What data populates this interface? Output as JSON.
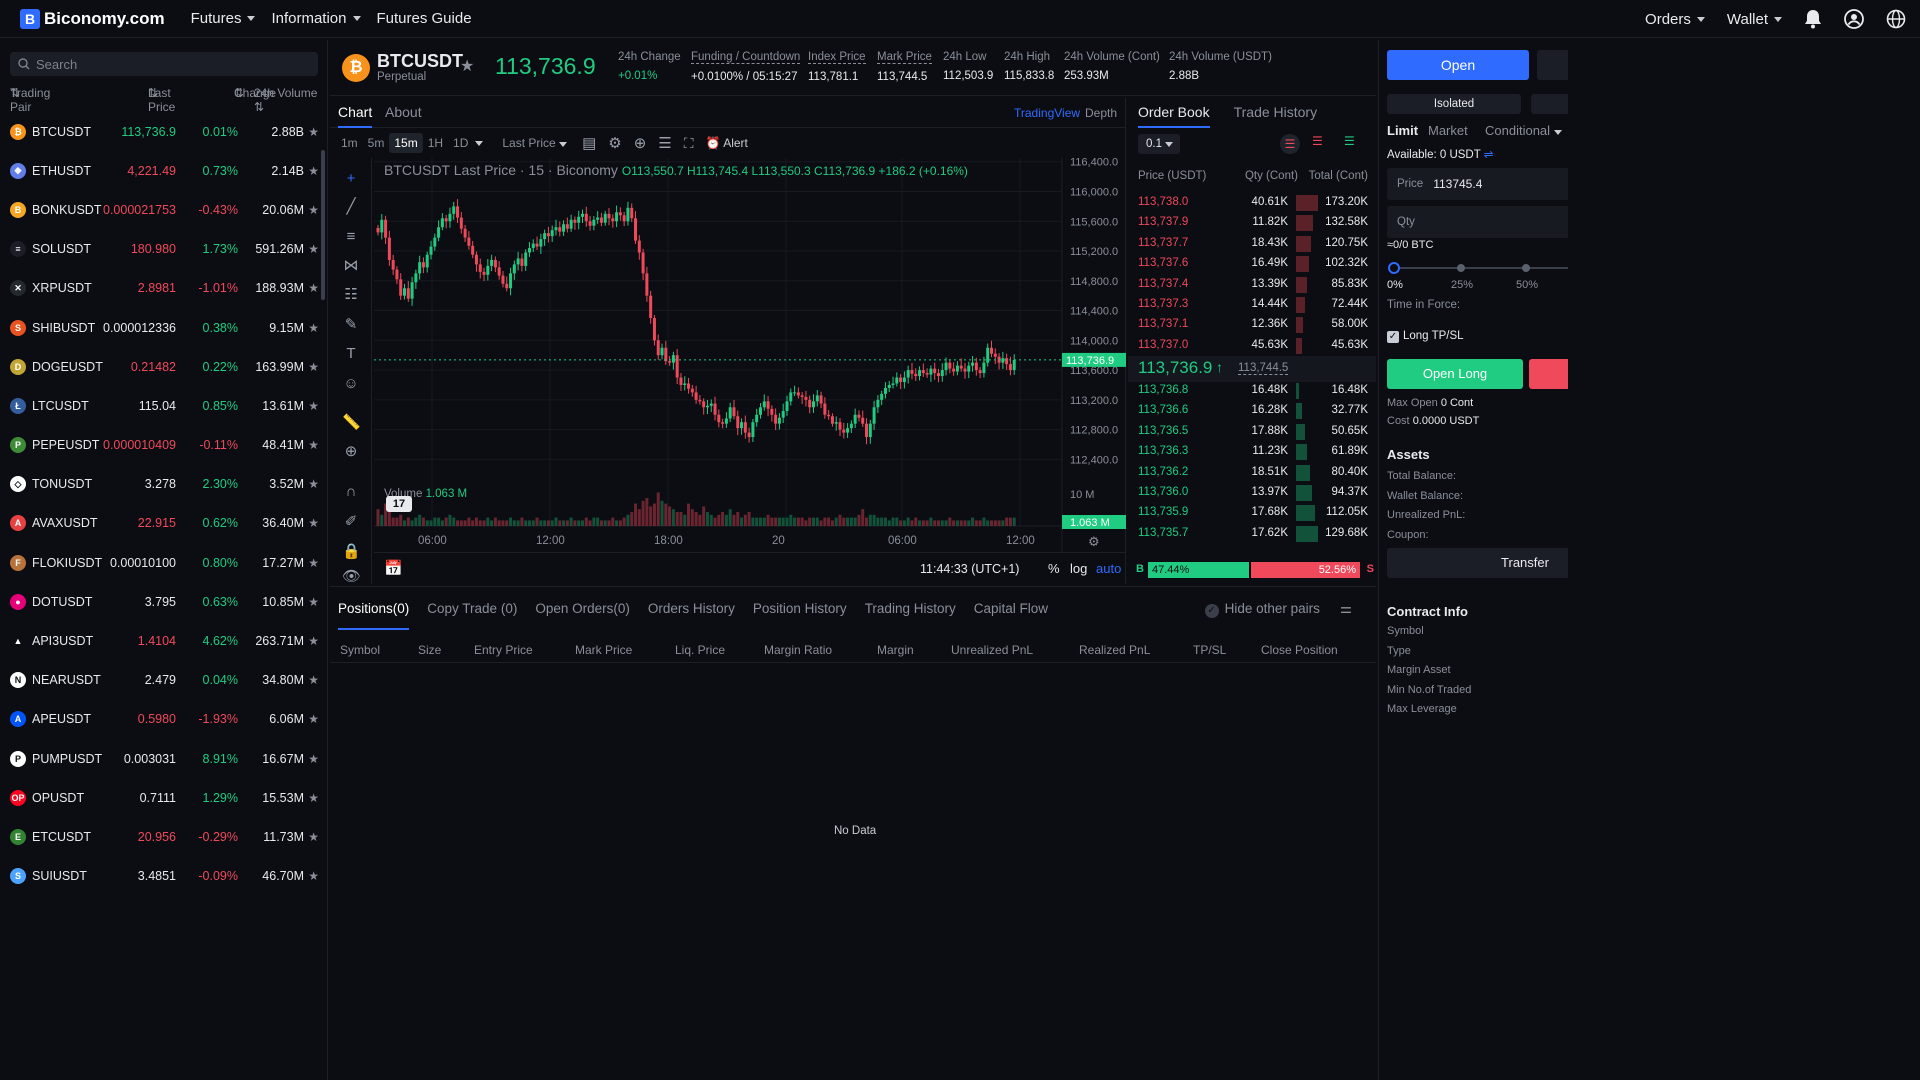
{
  "nav": {
    "brand": "Biconomy.com",
    "items": [
      "Futures",
      "Information",
      "Futures Guide"
    ],
    "right": [
      "Orders",
      "Wallet"
    ]
  },
  "search": {
    "placeholder": "Search"
  },
  "pairs_header": {
    "pair": "Trading Pair",
    "last": "Last Price",
    "change": "Change",
    "volume": "24h Volume"
  },
  "pairs": [
    {
      "symbol": "BTCUSDT",
      "last": "113,736.9",
      "change": "0.01%",
      "volume": "2.88B",
      "dir": "up",
      "icon_color": "#f7931a",
      "icon": "₿"
    },
    {
      "symbol": "ETHUSDT",
      "last": "4,221.49",
      "change": "0.73%",
      "volume": "2.14B",
      "dir": "down",
      "icon_color": "#627eea",
      "icon": "◆"
    },
    {
      "symbol": "BONKUSDT",
      "last": "0.000021753",
      "change": "-0.43%",
      "volume": "20.06M",
      "dir": "down",
      "icon_color": "#f5a623",
      "icon": "B"
    },
    {
      "symbol": "SOLUSDT",
      "last": "180.980",
      "change": "1.73%",
      "volume": "591.26M",
      "dir": "down",
      "icon_color": "#1b1e26",
      "icon": "≡"
    },
    {
      "symbol": "XRPUSDT",
      "last": "2.8981",
      "change": "-1.01%",
      "volume": "188.93M",
      "dir": "down",
      "icon_color": "#23292f",
      "icon": "✕"
    },
    {
      "symbol": "SHIBUSDT",
      "last": "0.000012336",
      "change": "0.38%",
      "volume": "9.15M",
      "dir": "none",
      "icon_color": "#e8531f",
      "icon": "S"
    },
    {
      "symbol": "DOGEUSDT",
      "last": "0.21482",
      "change": "0.22%",
      "volume": "163.99M",
      "dir": "down",
      "icon_color": "#c2a633",
      "icon": "D"
    },
    {
      "symbol": "LTCUSDT",
      "last": "115.04",
      "change": "0.85%",
      "volume": "13.61M",
      "dir": "none",
      "icon_color": "#345d9d",
      "icon": "Ł"
    },
    {
      "symbol": "PEPEUSDT",
      "last": "0.000010409",
      "change": "-0.11%",
      "volume": "48.41M",
      "dir": "down",
      "icon_color": "#3d8b37",
      "icon": "P"
    },
    {
      "symbol": "TONUSDT",
      "last": "3.278",
      "change": "2.30%",
      "volume": "3.52M",
      "dir": "none",
      "icon_color": "#ffffff",
      "icon": "◇"
    },
    {
      "symbol": "AVAXUSDT",
      "last": "22.915",
      "change": "0.62%",
      "volume": "36.40M",
      "dir": "down",
      "icon_color": "#e84142",
      "icon": "A"
    },
    {
      "symbol": "FLOKIUSDT",
      "last": "0.00010100",
      "change": "0.80%",
      "volume": "17.27M",
      "dir": "none",
      "icon_color": "#b8733a",
      "icon": "F"
    },
    {
      "symbol": "DOTUSDT",
      "last": "3.795",
      "change": "0.63%",
      "volume": "10.85M",
      "dir": "none",
      "icon_color": "#e6007a",
      "icon": "●"
    },
    {
      "symbol": "API3USDT",
      "last": "1.4104",
      "change": "4.62%",
      "volume": "263.71M",
      "dir": "down",
      "icon_color": "#0b0d12",
      "icon": "▲"
    },
    {
      "symbol": "NEARUSDT",
      "last": "2.479",
      "change": "0.04%",
      "volume": "34.80M",
      "dir": "none",
      "icon_color": "#ffffff",
      "icon": "N"
    },
    {
      "symbol": "APEUSDT",
      "last": "0.5980",
      "change": "-1.93%",
      "volume": "6.06M",
      "dir": "down",
      "icon_color": "#0054f9",
      "icon": "A"
    },
    {
      "symbol": "PUMPUSDT",
      "last": "0.003031",
      "change": "8.91%",
      "volume": "16.67M",
      "dir": "none",
      "icon_color": "#ffffff",
      "icon": "P"
    },
    {
      "symbol": "OPUSDT",
      "last": "0.7111",
      "change": "1.29%",
      "volume": "15.53M",
      "dir": "none",
      "icon_color": "#ff0420",
      "icon": "OP"
    },
    {
      "symbol": "ETCUSDT",
      "last": "20.956",
      "change": "-0.29%",
      "volume": "11.73M",
      "dir": "down",
      "icon_color": "#328332",
      "icon": "E"
    },
    {
      "symbol": "SUIUSDT",
      "last": "3.4851",
      "change": "-0.09%",
      "volume": "46.70M",
      "dir": "none",
      "icon_color": "#4da2ff",
      "icon": "S"
    }
  ],
  "ticker": {
    "symbol": "BTCUSDT",
    "type": "Perpetual",
    "price": "113,736.9",
    "stats": [
      {
        "label": "24h Change",
        "value": "+0.01%",
        "dotted": false,
        "color": "green"
      },
      {
        "label": "Funding / Countdown",
        "value": "+0.0100% / 05:15:27",
        "dotted": true,
        "color": "white"
      },
      {
        "label": "Index Price",
        "value": "113,781.1",
        "dotted": true,
        "color": "white"
      },
      {
        "label": "Mark Price",
        "value": "113,744.5",
        "dotted": true,
        "color": "white"
      },
      {
        "label": "24h Low",
        "value": "112,503.9",
        "dotted": false,
        "color": "white"
      },
      {
        "label": "24h High",
        "value": "115,833.8",
        "dotted": false,
        "color": "white"
      },
      {
        "label": "24h Volume (Cont)",
        "value": "253.93M",
        "dotted": false,
        "color": "white"
      },
      {
        "label": "24h Volume (USDT)",
        "value": "2.88B",
        "dotted": false,
        "color": "white"
      }
    ]
  },
  "chart_tabs": {
    "chart": "Chart",
    "about": "About",
    "tradingview": "TradingView",
    "depth": "Depth"
  },
  "chart_toolbar": {
    "intervals": [
      "1m",
      "5m",
      "15m",
      "1H",
      "1D"
    ],
    "selected": "15m",
    "price_type": "Last Price",
    "alert": "Alert"
  },
  "chart_header": {
    "title": "BTCUSDT Last Price · 15 · Biconomy",
    "o": "O113,550.7",
    "h": "H113,745.4",
    "l": "L113,550.3",
    "c": "C113,736.9",
    "chg": "+186.2 (+0.16%)"
  },
  "chart_data": {
    "type": "candlestick",
    "y_ticks": [
      "116,400.0",
      "116,000.0",
      "115,600.0",
      "115,200.0",
      "114,800.0",
      "114,400.0",
      "114,000.0",
      "113,600.0",
      "113,200.0",
      "112,800.0",
      "112,400.0"
    ],
    "ylim": [
      112150,
      116450
    ],
    "x_ticks": [
      "06:00",
      "12:00",
      "18:00",
      "20",
      "06:00",
      "12:00"
    ],
    "last_price_label": "113,736.9",
    "volume_label": "Volume",
    "volume_value": "1.063 M",
    "volume_axis": "10 M",
    "volume_tag": "1.063 M",
    "closes": [
      115450,
      115620,
      115380,
      115080,
      114950,
      114820,
      114600,
      114700,
      114560,
      114780,
      114900,
      115050,
      114980,
      115150,
      115260,
      115380,
      115520,
      115640,
      115600,
      115700,
      115800,
      115650,
      115500,
      115380,
      115270,
      115150,
      115020,
      114920,
      114880,
      115000,
      115080,
      114980,
      114870,
      114760,
      114700,
      114900,
      115020,
      115100,
      115000,
      115180,
      115240,
      115300,
      115260,
      115360,
      115440,
      115400,
      115480,
      115520,
      115460,
      115560,
      115500,
      115620,
      115580,
      115660,
      115700,
      115600,
      115540,
      115620,
      115650,
      115580,
      115700,
      115640,
      115600,
      115720,
      115680,
      115600,
      115780,
      115640,
      115340,
      115180,
      114900,
      114600,
      114300,
      114000,
      113800,
      113900,
      113720,
      113700,
      113800,
      113500,
      113400,
      113420,
      113350,
      113300,
      113200,
      113180,
      113100,
      113120,
      113150,
      113000,
      112900,
      112880,
      112950,
      113100,
      112980,
      112820,
      112900,
      112760,
      112700,
      112900,
      113000,
      113100,
      113180,
      113080,
      113000,
      112880,
      112960,
      113050,
      113180,
      113300,
      113300,
      113260,
      113240,
      113200,
      113100,
      113180,
      113260,
      113150,
      113000,
      112980,
      112880,
      112900,
      112800,
      112760,
      112820,
      112880,
      113000,
      112960,
      112880,
      112700,
      112880,
      113100,
      113200,
      113280,
      113360,
      113400,
      113420,
      113500,
      113440,
      113500,
      113600,
      113550,
      113520,
      113600,
      113560,
      113540,
      113620,
      113560,
      113520,
      113600,
      113700,
      113620,
      113580,
      113660,
      113620,
      113580,
      113660,
      113700,
      113600,
      113560,
      113700,
      113900,
      113820,
      113780,
      113700,
      113760,
      113680,
      113600,
      113736.9
    ],
    "volumes": [
      6,
      4,
      8,
      5,
      3,
      3,
      4,
      2,
      3,
      2,
      3,
      4,
      3,
      2,
      2,
      3,
      3,
      2,
      3,
      4,
      3,
      2,
      2,
      2,
      3,
      2,
      3,
      2,
      2,
      3,
      2,
      3,
      2,
      2,
      2,
      3,
      2,
      2,
      3,
      2,
      2,
      2,
      3,
      2,
      2,
      2,
      2,
      3,
      2,
      2,
      2,
      3,
      2,
      2,
      2,
      3,
      2,
      3,
      3,
      2,
      2,
      2,
      3,
      2,
      2,
      3,
      4,
      5,
      8,
      6,
      9,
      10,
      7,
      8,
      12,
      9,
      8,
      7,
      6,
      5,
      5,
      4,
      8,
      6,
      5,
      4,
      7,
      5,
      4,
      3,
      4,
      5,
      4,
      6,
      4,
      5,
      3,
      4,
      5,
      3,
      3,
      3,
      3,
      4,
      3,
      3,
      3,
      3,
      3,
      4,
      3,
      3,
      3,
      2,
      3,
      3,
      3,
      2,
      3,
      3,
      2,
      3,
      4,
      3,
      3,
      3,
      3,
      4,
      6,
      3,
      4,
      4,
      3,
      3,
      3,
      2,
      3,
      3,
      2,
      2,
      3,
      2,
      3,
      2,
      2,
      2,
      3,
      2,
      2,
      2,
      2,
      3,
      2,
      2,
      2,
      2,
      2,
      3,
      2,
      2,
      3,
      2,
      2,
      2,
      2,
      2,
      3,
      3,
      3
    ]
  },
  "chart_footer": {
    "time": "11:44:33 (UTC+1)",
    "pct": "%",
    "log": "log",
    "auto": "auto"
  },
  "orderbook": {
    "tabs": [
      "Order Book",
      "Trade History"
    ],
    "precision": "0.1",
    "headers": {
      "price": "Price (USDT)",
      "qty": "Qty (Cont)",
      "total": "Total (Cont)"
    },
    "asks": [
      {
        "price": "113,738.0",
        "qty": "40.61K",
        "total": "173.20K",
        "depth": 1.0
      },
      {
        "price": "113,737.9",
        "qty": "11.82K",
        "total": "132.58K",
        "depth": 0.77
      },
      {
        "price": "113,737.7",
        "qty": "18.43K",
        "total": "120.75K",
        "depth": 0.7
      },
      {
        "price": "113,737.6",
        "qty": "16.49K",
        "total": "102.32K",
        "depth": 0.59
      },
      {
        "price": "113,737.4",
        "qty": "13.39K",
        "total": "85.83K",
        "depth": 0.5
      },
      {
        "price": "113,737.3",
        "qty": "14.44K",
        "total": "72.44K",
        "depth": 0.42
      },
      {
        "price": "113,737.1",
        "qty": "12.36K",
        "total": "58.00K",
        "depth": 0.33
      },
      {
        "price": "113,737.0",
        "qty": "45.63K",
        "total": "45.63K",
        "depth": 0.26
      }
    ],
    "mid": {
      "price": "113,736.9",
      "arrow": "↑",
      "mark": "113,744.5"
    },
    "bids": [
      {
        "price": "113,736.8",
        "qty": "16.48K",
        "total": "16.48K",
        "depth": 0.13
      },
      {
        "price": "113,736.6",
        "qty": "16.28K",
        "total": "32.77K",
        "depth": 0.25
      },
      {
        "price": "113,736.5",
        "qty": "17.88K",
        "total": "50.65K",
        "depth": 0.39
      },
      {
        "price": "113,736.3",
        "qty": "11.23K",
        "total": "61.89K",
        "depth": 0.48
      },
      {
        "price": "113,736.2",
        "qty": "18.51K",
        "total": "80.40K",
        "depth": 0.62
      },
      {
        "price": "113,736.0",
        "qty": "13.97K",
        "total": "94.37K",
        "depth": 0.73
      },
      {
        "price": "113,735.9",
        "qty": "17.68K",
        "total": "112.05K",
        "depth": 0.87
      },
      {
        "price": "113,735.7",
        "qty": "17.62K",
        "total": "129.68K",
        "depth": 1.0
      }
    ],
    "ratio": {
      "b": "B",
      "buy": "47.44%",
      "sell": "52.56%",
      "s": "S",
      "buy_fraction": 0.4744
    }
  },
  "trade": {
    "open": "Open",
    "isolated": "Isolated",
    "types": [
      "Limit",
      "Market",
      "Conditional"
    ],
    "available_label": "Available:",
    "available": "0 USDT",
    "price_label": "Price",
    "price_value": "113745.4",
    "qty_placeholder": "Qty",
    "qty_unit": "≈0/0 BTC",
    "slider_marks": [
      "0%",
      "25%",
      "50%"
    ],
    "time_in_force": "Time in Force:",
    "tpsl": "Long TP/SL",
    "open_long": "Open Long",
    "max_open_label": "Max Open",
    "max_open": "0 Cont",
    "cost_label": "Cost",
    "cost": "0.0000 USDT",
    "assets_title": "Assets",
    "assets": [
      "Total Balance:",
      "Wallet Balance:",
      "Unrealized PnL:",
      "Coupon:"
    ],
    "transfer": "Transfer",
    "contract_title": "Contract Info",
    "contract": [
      "Symbol",
      "Type",
      "Margin Asset",
      "Min No.of Traded",
      "Max Leverage"
    ]
  },
  "positions": {
    "tabs": [
      "Positions(0)",
      "Copy Trade (0)",
      "Open Orders(0)",
      "Orders History",
      "Position History",
      "Trading History",
      "Capital Flow"
    ],
    "hide_other": "Hide other pairs",
    "headers": [
      "Symbol",
      "Size",
      "Entry Price",
      "Mark Price",
      "Liq. Price",
      "Margin Ratio",
      "Margin",
      "Unrealized PnL",
      "Realized PnL",
      "TP/SL",
      "Close Position"
    ],
    "empty": "No Data"
  },
  "colors": {
    "up": "#1fcc82",
    "down": "#f0495c",
    "accent": "#2f6bff",
    "bg": "#0b0d12"
  }
}
